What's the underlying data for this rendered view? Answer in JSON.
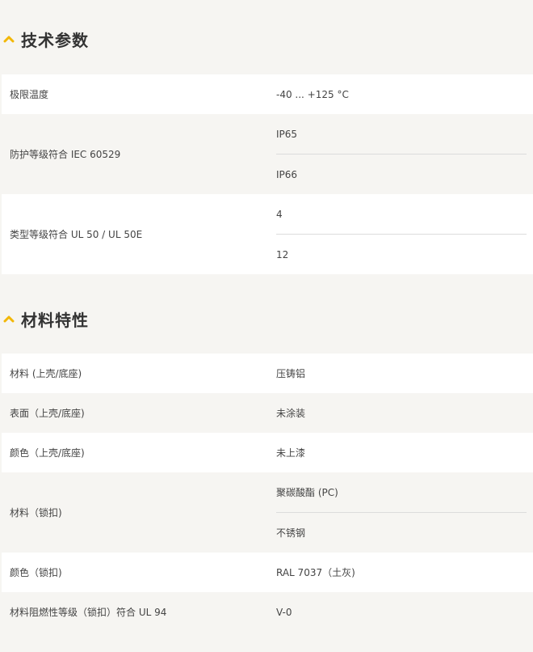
{
  "sections": [
    {
      "title": "技术参数",
      "rows": [
        {
          "label": "极限温度",
          "values": [
            "-40 ... +125 °C"
          ]
        },
        {
          "label": "防护等级符合 IEC 60529",
          "values": [
            "IP65",
            "IP66"
          ]
        },
        {
          "label": "类型等级符合 UL 50 / UL 50E",
          "values": [
            "4",
            "12"
          ]
        }
      ]
    },
    {
      "title": "材料特性",
      "rows": [
        {
          "label": "材料 (上壳/底座)",
          "values": [
            "压铸铝"
          ]
        },
        {
          "label": "表面（上壳/底座)",
          "values": [
            "未涂装"
          ]
        },
        {
          "label": "颜色（上壳/底座)",
          "values": [
            "未上漆"
          ]
        },
        {
          "label": "材料（锁扣)",
          "values": [
            "聚碳酸酯 (PC)",
            "不锈钢"
          ]
        },
        {
          "label": "颜色（锁扣)",
          "values": [
            "RAL 7037（土灰)"
          ]
        },
        {
          "label": "材料阻燃性等级（锁扣）符合 UL 94",
          "values": [
            "V-0"
          ]
        }
      ]
    }
  ],
  "icons": {
    "section_toggle": "chevron-up-icon",
    "accent_color": "#f2b705"
  },
  "colors": {
    "row_white": "#ffffff",
    "row_grey": "#f6f5f2",
    "divider": "#dcdcdc"
  }
}
